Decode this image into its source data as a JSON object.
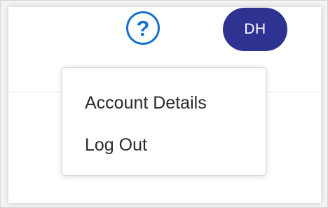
{
  "header": {
    "help_icon_glyph": "?",
    "avatar_initials": "DH",
    "help_color": "#1a73c9",
    "avatar_color": "#2e3290"
  },
  "account_menu": {
    "items": [
      {
        "label": "Account Details"
      },
      {
        "label": "Log Out"
      }
    ]
  }
}
